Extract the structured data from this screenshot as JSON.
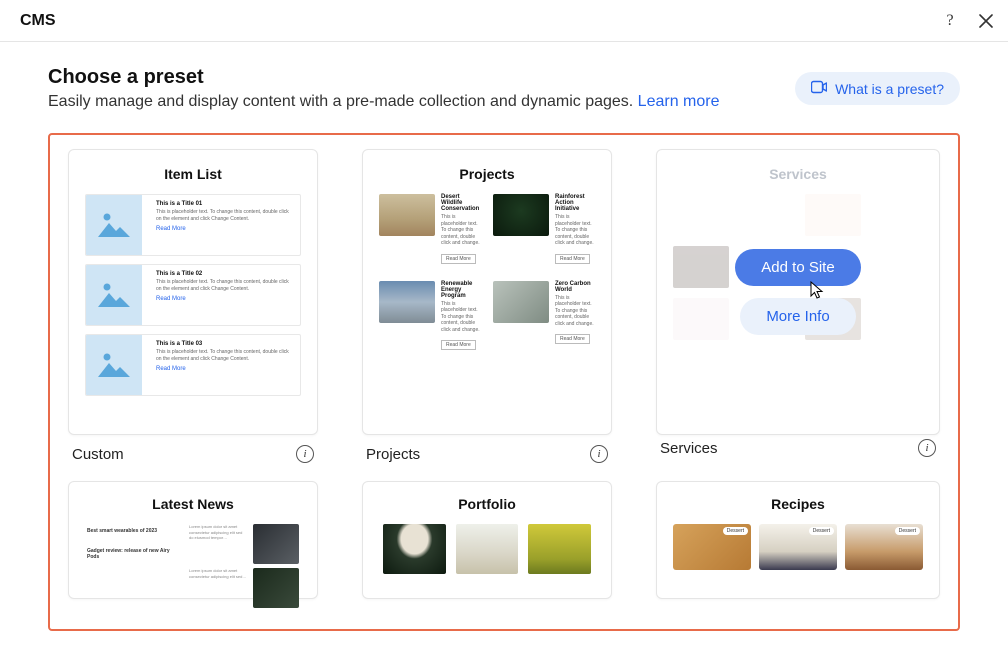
{
  "header": {
    "title": "CMS"
  },
  "heading": {
    "title": "Choose a preset",
    "subtitle": "Easily manage and display content with a pre-made collection and dynamic pages. ",
    "learn_more": "Learn more",
    "preset_btn": "What is a preset?"
  },
  "overlay": {
    "add_to_site": "Add to Site",
    "more_info": "More Info"
  },
  "presets": [
    {
      "label": "Custom",
      "card_title": "Item List",
      "items": [
        {
          "title": "This is a Title 01",
          "desc": "This is placeholder text. To change this content, double click on the element and click Change Content.",
          "link": "Read More"
        },
        {
          "title": "This is a Title 02",
          "desc": "This is placeholder text. To change this content, double click on the element and click Change Content.",
          "link": "Read More"
        },
        {
          "title": "This is a Title 03",
          "desc": "This is placeholder text. To change this content, double click on the element and click Change Content.",
          "link": "Read More"
        }
      ]
    },
    {
      "label": "Projects",
      "card_title": "Projects",
      "items": [
        {
          "title": "Desert Wildlife Conservation",
          "desc": "This is placeholder text. To change this content, double click and change.",
          "btn": "Read More"
        },
        {
          "title": "Rainforest Action Initiative",
          "desc": "This is placeholder text. To change this content, double click and change.",
          "btn": "Read More"
        },
        {
          "title": "Renewable Energy Program",
          "desc": "This is placeholder text. To change this content, double click and change.",
          "btn": "Read More"
        },
        {
          "title": "Zero Carbon World",
          "desc": "This is placeholder text. To change this content, double click and change.",
          "btn": "Read More"
        }
      ]
    },
    {
      "label": "Services",
      "card_title": "Services"
    },
    {
      "label": "",
      "card_title": "Latest News",
      "headlines": [
        "Best smart wearables of 2023",
        "Gadget review: release of new Airy Pods"
      ]
    },
    {
      "label": "",
      "card_title": "Portfolio"
    },
    {
      "label": "",
      "card_title": "Recipes",
      "tags": [
        "Dessert",
        "Dessert",
        "Dessert"
      ]
    }
  ]
}
